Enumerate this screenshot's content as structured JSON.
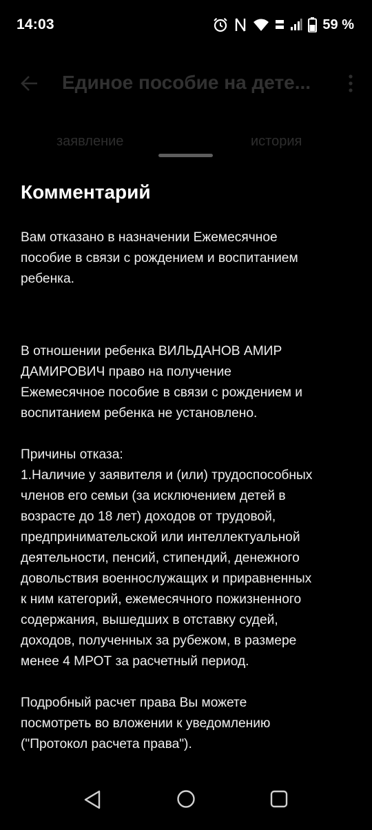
{
  "status_bar": {
    "time": "14:03",
    "battery": "59 %",
    "icons": [
      "alarm-icon",
      "nfc-icon",
      "wifi-icon",
      "volte-icon",
      "signal-icon",
      "battery-icon"
    ]
  },
  "app_bar": {
    "title": "Единое пособие на дете...",
    "back_icon": "arrow-left-icon",
    "more_icon": "more-vertical-icon"
  },
  "tabs": [
    {
      "label": "заявление"
    },
    {
      "label": "история"
    }
  ],
  "sheet": {
    "title": "Комментарий",
    "paragraphs": [
      "Вам отказано в назначении Ежемесячное\nпособие в связи с рождением и воспитанием\nребенка.",
      "В отношении ребенка ВИЛЬДАНОВ АМИР\nДАМИРОВИЧ право на получение\nЕжемесячное пособие в связи с рождением и\nвоспитанием ребенка не установлено.",
      "Причины отказа:\n1.Наличие у заявителя и (или) трудоспособных\nчленов его семьи (за исключением детей в\nвозрасте до 18 лет) доходов от трудовой,\nпредпринимательской или интеллектуальной\nдеятельности, пенсий, стипендий, денежного\nдовольствия военнослужащих и приравненных\nк ним категорий, ежемесячного пожизненного\nсодержания, вышедших в отставку судей,\nдоходов, полученных за рубежом, в размере\nменее 4 МРОТ за расчетный период.",
      "Подробный расчет права Вы можете\nпосмотреть во вложении к уведомлению\n(\"Протокол расчета права\")."
    ]
  },
  "nav_bar": {
    "icons": [
      "nav-back-icon",
      "nav-home-icon",
      "nav-recents-icon"
    ]
  },
  "colors": {
    "background": "#000000",
    "text": "#ffffff",
    "handle": "#5d5d5d"
  }
}
